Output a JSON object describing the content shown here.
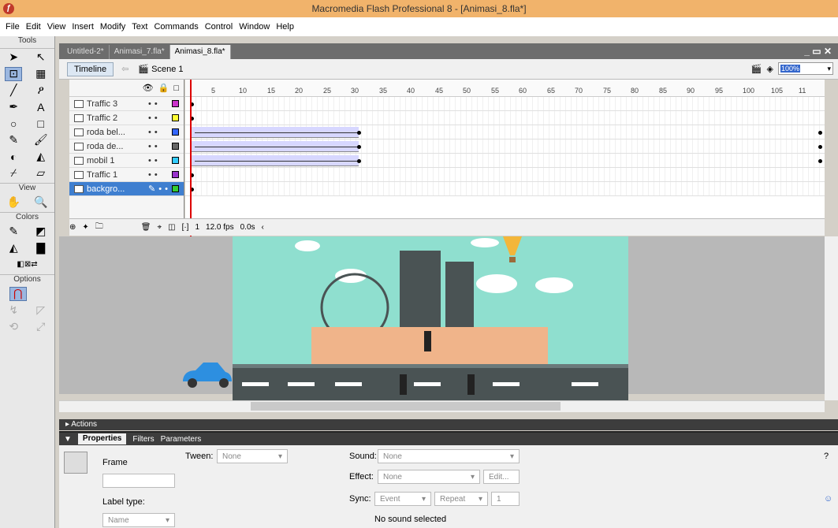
{
  "window": {
    "title": "Macromedia Flash Professional 8 - [Animasi_8.fla*]"
  },
  "menu": [
    "File",
    "Edit",
    "View",
    "Insert",
    "Modify",
    "Text",
    "Commands",
    "Control",
    "Window",
    "Help"
  ],
  "tools": {
    "header": "Tools",
    "view": "View",
    "colors": "Colors",
    "options": "Options"
  },
  "tabs": [
    "Untitled-2*",
    "Animasi_7.fla*",
    "Animasi_8.fla*"
  ],
  "timeline": {
    "button": "Timeline",
    "scene": "Scene 1",
    "zoom": "100%"
  },
  "layers": [
    {
      "name": "Traffic 3",
      "color": "#cc33cc"
    },
    {
      "name": "Traffic 2",
      "color": "#ffff33"
    },
    {
      "name": "roda bel...",
      "color": "#3366ff"
    },
    {
      "name": "roda de...",
      "color": "#666666"
    },
    {
      "name": "mobil 1",
      "color": "#33ccff"
    },
    {
      "name": "Traffic 1",
      "color": "#9933cc"
    },
    {
      "name": "backgro...",
      "color": "#33cc33"
    }
  ],
  "ruler": [
    "5",
    "10",
    "15",
    "20",
    "25",
    "30",
    "35",
    "40",
    "45",
    "50",
    "55",
    "60",
    "65",
    "70",
    "75",
    "80",
    "85",
    "90",
    "95",
    "100",
    "105",
    "11"
  ],
  "footer": {
    "frame": "1",
    "fps": "12.0 fps",
    "time": "0.0s"
  },
  "actions": "Actions",
  "props": {
    "tabs": [
      "Properties",
      "Filters",
      "Parameters"
    ],
    "frame": "Frame",
    "tween_label": "Tween:",
    "tween": "None",
    "sound_label": "Sound:",
    "sound": "None",
    "effect_label": "Effect:",
    "effect": "None",
    "edit": "Edit...",
    "sync_label": "Sync:",
    "sync": "Event",
    "repeat": "Repeat",
    "repeat_n": "1",
    "no_sound": "No sound selected",
    "label_type": "Label type:",
    "name": "Name"
  }
}
